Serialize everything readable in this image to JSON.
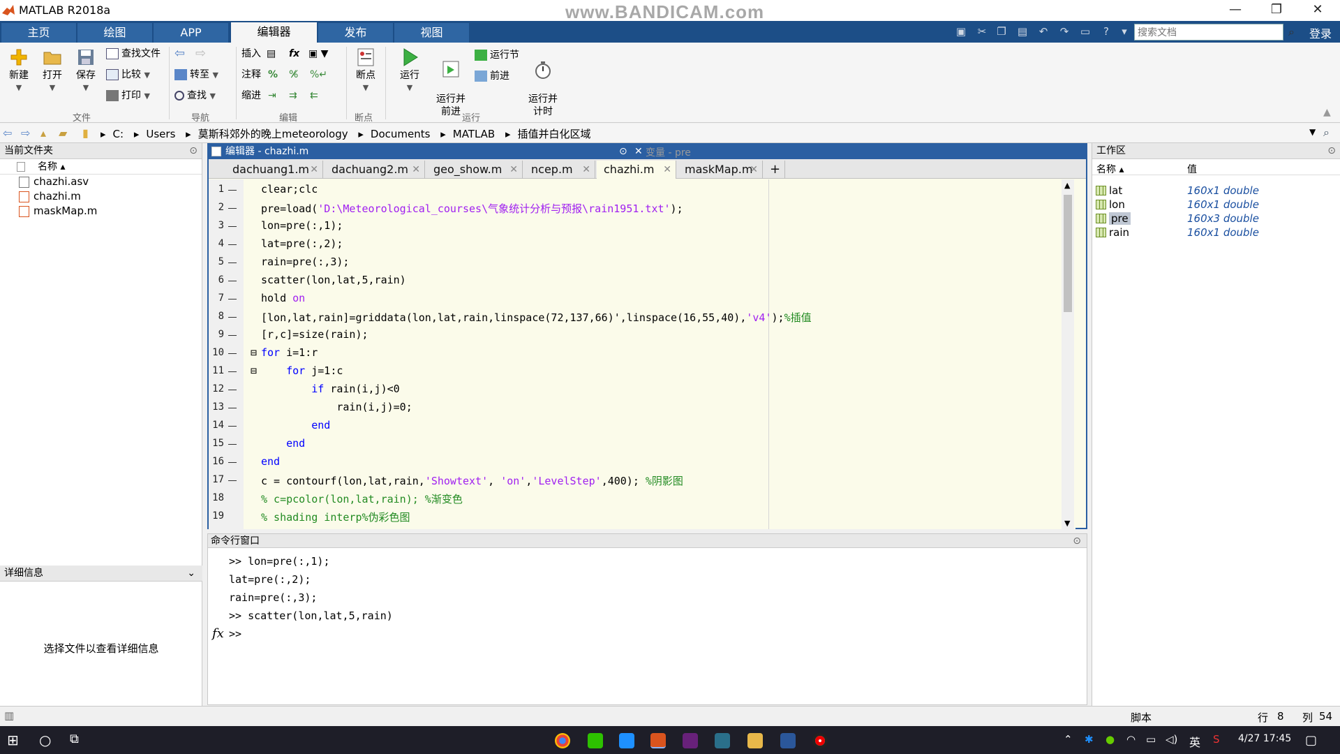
{
  "window": {
    "title": "MATLAB R2018a",
    "watermark": "www.BANDICAM.com",
    "minimize": "—",
    "restore": "❐",
    "close": "✕"
  },
  "ribbon_tabs": [
    "主页",
    "绘图",
    "APP",
    "编辑器",
    "发布",
    "视图"
  ],
  "search": {
    "placeholder": "搜索文档"
  },
  "login_label": "登录",
  "ribbon": {
    "file": {
      "new": "新建",
      "open": "打开",
      "save": "保存",
      "find_files": "查找文件",
      "compare": "比较",
      "print": "打印",
      "group": "文件"
    },
    "navigate": {
      "goto": "转至",
      "find": "查找",
      "group": "导航"
    },
    "edit": {
      "insert": "插入",
      "comment": "注释",
      "indent": "缩进",
      "group": "编辑"
    },
    "breakpoints": {
      "label": "断点",
      "group": "断点"
    },
    "run": {
      "run": "运行",
      "run_advance": "运行并\n前进",
      "run_section": "运行节",
      "advance": "前进",
      "run_time": "运行并\n计时",
      "group": "运行"
    }
  },
  "address": [
    "C:",
    "Users",
    "莫斯科郊外的晚上meteorology",
    "Documents",
    "MATLAB",
    "插值并白化区域"
  ],
  "current_folder": {
    "title": "当前文件夹",
    "col_name": "名称 ▴",
    "files": [
      "chazhi.asv",
      "chazhi.m",
      "maskMap.m"
    ]
  },
  "details": {
    "title": "详细信息",
    "text": "选择文件以查看详细信息"
  },
  "editor": {
    "title": "编辑器 - chazhi.m",
    "variables_tab": "变量 - pre",
    "tabs": [
      "dachuang1.m",
      "dachuang2.m",
      "geo_show.m",
      "ncep.m",
      "chazhi.m",
      "maskMap.m"
    ],
    "active_tab": "chazhi.m",
    "add_tab": "+",
    "line_numbers": [
      "1",
      "2",
      "3",
      "4",
      "5",
      "6",
      "7",
      "8",
      "9",
      "10",
      "11",
      "12",
      "13",
      "14",
      "15",
      "16",
      "17",
      "18",
      "19"
    ]
  },
  "command_window": {
    "title": "命令行窗口",
    "lines": [
      ">> lon=pre(:,1);",
      "lat=pre(:,2);",
      "rain=pre(:,3);",
      ">> scatter(lon,lat,5,rain)"
    ],
    "prompt": ">>",
    "fx": "fx"
  },
  "workspace": {
    "title": "工作区",
    "col_name": "名称 ▴",
    "col_value": "值",
    "vars": [
      {
        "name": "lat",
        "value": "160x1 double"
      },
      {
        "name": "lon",
        "value": "160x1 double"
      },
      {
        "name": "pre",
        "value": "160x3 double"
      },
      {
        "name": "rain",
        "value": "160x1 double"
      }
    ]
  },
  "status": {
    "type": "脚本",
    "row_label": "行",
    "row": "8",
    "col_label": "列",
    "col": "54"
  },
  "taskbar": {
    "ime": "英",
    "datetime": "4/27 17:45"
  }
}
